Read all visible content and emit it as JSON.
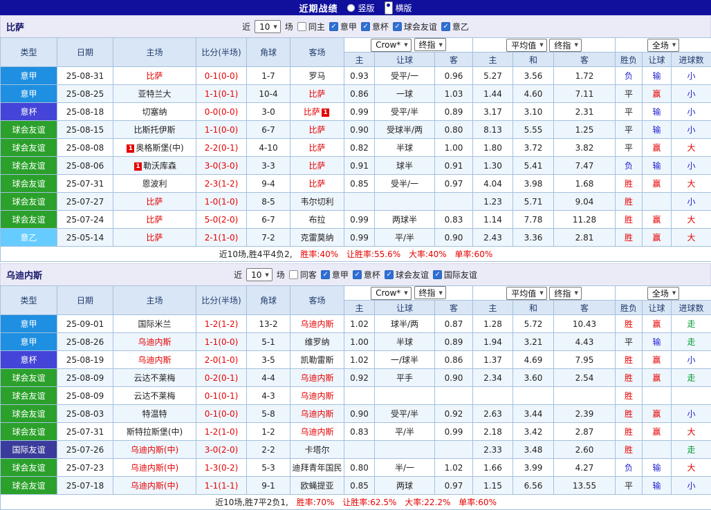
{
  "top_bar": {
    "title": "近期战绩",
    "view_options": [
      {
        "label": "竖版",
        "selected": false
      },
      {
        "label": "横版",
        "selected": true
      }
    ]
  },
  "table_headers": {
    "type": "类型",
    "date": "日期",
    "home": "主场",
    "score": "比分(半场)",
    "corners": "角球",
    "away": "客场",
    "odds_sub": [
      "主",
      "让球",
      "客"
    ],
    "avg_sub": [
      "主",
      "和",
      "客"
    ],
    "result_sub": [
      "胜负",
      "让球",
      "进球数"
    ]
  },
  "colors": {
    "serie_a_badge": "#1e8fe1",
    "coppa_badge": "#4444d8",
    "club_friendly_badge": "#2ba12b",
    "serie_b_badge": "#66ccff",
    "intl_friendly_badge": "#3b3b9b",
    "win_red": "#e60000",
    "lose_blue": "#1f1fd0",
    "walk_green": "#009933",
    "topbar_blue": "#10109d"
  },
  "sections": [
    {
      "team": "比萨",
      "filter": {
        "near_label": "近",
        "count": "10",
        "games_label": "场",
        "checkboxes": [
          {
            "label": "同主",
            "checked": false
          },
          {
            "label": "意甲",
            "checked": true
          },
          {
            "label": "意杯",
            "checked": true
          },
          {
            "label": "球会友谊",
            "checked": true
          },
          {
            "label": "意乙",
            "checked": true
          }
        ]
      },
      "selects": {
        "odds_source": "Crow*",
        "odds_kind": "终指",
        "avg": "平均值",
        "avg_kind": "终指",
        "scope": "全场"
      },
      "rows": [
        {
          "type": "意甲",
          "date": "25-08-31",
          "home": {
            "name": "比萨",
            "focus": true
          },
          "score": "0-1(0-0)",
          "corners": "1-7",
          "away": {
            "name": "罗马"
          },
          "odds": [
            "0.93",
            "受平/一",
            "0.96"
          ],
          "avg": [
            "5.27",
            "3.56",
            "1.72"
          ],
          "result": "负",
          "handicap": "输",
          "goals": "小"
        },
        {
          "type": "意甲",
          "date": "25-08-25",
          "home": {
            "name": "亚特兰大"
          },
          "score": "1-1(0-1)",
          "corners": "10-4",
          "away": {
            "name": "比萨",
            "focus": true
          },
          "odds": [
            "0.86",
            "一球",
            "1.03"
          ],
          "avg": [
            "1.44",
            "4.60",
            "7.11"
          ],
          "result": "平",
          "handicap": "赢",
          "goals": "小"
        },
        {
          "type": "意杯",
          "date": "25-08-18",
          "home": {
            "name": "切塞纳"
          },
          "score": "0-0(0-0)",
          "corners": "3-0",
          "away": {
            "name": "比萨",
            "focus": true,
            "badge": "1",
            "badge_pos": "after"
          },
          "odds": [
            "0.99",
            "受平/半",
            "0.89"
          ],
          "avg": [
            "3.17",
            "3.10",
            "2.31"
          ],
          "result": "平",
          "handicap": "输",
          "goals": "小"
        },
        {
          "type": "球会友谊",
          "date": "25-08-15",
          "home": {
            "name": "比斯托伊斯"
          },
          "score": "1-1(0-0)",
          "corners": "6-7",
          "away": {
            "name": "比萨",
            "focus": true
          },
          "odds": [
            "0.90",
            "受球半/两",
            "0.80"
          ],
          "avg": [
            "8.13",
            "5.55",
            "1.25"
          ],
          "result": "平",
          "handicap": "输",
          "goals": "小"
        },
        {
          "type": "球会友谊",
          "date": "25-08-08",
          "home": {
            "name": "奥格斯堡(中)",
            "badge": "1",
            "badge_pos": "before"
          },
          "score": "2-2(0-1)",
          "corners": "4-10",
          "away": {
            "name": "比萨",
            "focus": true
          },
          "odds": [
            "0.82",
            "半球",
            "1.00"
          ],
          "avg": [
            "1.80",
            "3.72",
            "3.82"
          ],
          "result": "平",
          "handicap": "赢",
          "goals": "大"
        },
        {
          "type": "球会友谊",
          "date": "25-08-06",
          "home": {
            "name": "勒沃库森",
            "badge": "1",
            "badge_pos": "before"
          },
          "score": "3-0(3-0)",
          "corners": "3-3",
          "away": {
            "name": "比萨",
            "focus": true
          },
          "odds": [
            "0.91",
            "球半",
            "0.91"
          ],
          "avg": [
            "1.30",
            "5.41",
            "7.47"
          ],
          "result": "负",
          "handicap": "输",
          "goals": "小"
        },
        {
          "type": "球会友谊",
          "date": "25-07-31",
          "home": {
            "name": "恩波利"
          },
          "score": "2-3(1-2)",
          "corners": "9-4",
          "away": {
            "name": "比萨",
            "focus": true
          },
          "odds": [
            "0.85",
            "受半/一",
            "0.97"
          ],
          "avg": [
            "4.04",
            "3.98",
            "1.68"
          ],
          "result": "胜",
          "handicap": "赢",
          "goals": "大"
        },
        {
          "type": "球会友谊",
          "date": "25-07-27",
          "home": {
            "name": "比萨",
            "focus": true
          },
          "score": "1-0(1-0)",
          "corners": "8-5",
          "away": {
            "name": "韦尔切利"
          },
          "odds": [
            "",
            "",
            ""
          ],
          "avg": [
            "1.23",
            "5.71",
            "9.04"
          ],
          "result": "胜",
          "handicap": "",
          "goals": "小"
        },
        {
          "type": "球会友谊",
          "date": "25-07-24",
          "home": {
            "name": "比萨",
            "focus": true
          },
          "score": "5-0(2-0)",
          "corners": "6-7",
          "away": {
            "name": "布拉"
          },
          "odds": [
            "0.99",
            "两球半",
            "0.83"
          ],
          "avg": [
            "1.14",
            "7.78",
            "11.28"
          ],
          "result": "胜",
          "handicap": "赢",
          "goals": "大"
        },
        {
          "type": "意乙",
          "date": "25-05-14",
          "home": {
            "name": "比萨",
            "focus": true
          },
          "score": "2-1(1-0)",
          "corners": "7-2",
          "away": {
            "name": "克雷莫纳"
          },
          "odds": [
            "0.99",
            "平/半",
            "0.90"
          ],
          "avg": [
            "2.43",
            "3.36",
            "2.81"
          ],
          "result": "胜",
          "handicap": "赢",
          "goals": "大"
        }
      ],
      "summary": {
        "prefix": "近10场,胜4平4负2,",
        "rates": [
          "胜率:40%",
          "让胜率:55.6%",
          "大率:40%",
          "单率:60%"
        ]
      }
    },
    {
      "team": "乌迪内斯",
      "filter": {
        "near_label": "近",
        "count": "10",
        "games_label": "场",
        "checkboxes": [
          {
            "label": "同客",
            "checked": false
          },
          {
            "label": "意甲",
            "checked": true
          },
          {
            "label": "意杯",
            "checked": true
          },
          {
            "label": "球会友谊",
            "checked": true
          },
          {
            "label": "国际友谊",
            "checked": true
          }
        ]
      },
      "selects": {
        "odds_source": "Crow*",
        "odds_kind": "终指",
        "avg": "平均值",
        "avg_kind": "终指",
        "scope": "全场"
      },
      "rows": [
        {
          "type": "意甲",
          "date": "25-09-01",
          "home": {
            "name": "国际米兰"
          },
          "score": "1-2(1-2)",
          "corners": "13-2",
          "away": {
            "name": "乌迪内斯",
            "focus": true
          },
          "odds": [
            "1.02",
            "球半/两",
            "0.87"
          ],
          "avg": [
            "1.28",
            "5.72",
            "10.43"
          ],
          "result": "胜",
          "handicap": "赢",
          "goals": "走"
        },
        {
          "type": "意甲",
          "date": "25-08-26",
          "home": {
            "name": "乌迪内斯",
            "focus": true
          },
          "score": "1-1(0-0)",
          "corners": "5-1",
          "away": {
            "name": "维罗纳"
          },
          "odds": [
            "1.00",
            "半球",
            "0.89"
          ],
          "avg": [
            "1.94",
            "3.21",
            "4.43"
          ],
          "result": "平",
          "handicap": "输",
          "goals": "走"
        },
        {
          "type": "意杯",
          "date": "25-08-19",
          "home": {
            "name": "乌迪内斯",
            "focus": true
          },
          "score": "2-0(1-0)",
          "corners": "3-5",
          "away": {
            "name": "凯勒雷斯"
          },
          "odds": [
            "1.02",
            "一/球半",
            "0.86"
          ],
          "avg": [
            "1.37",
            "4.69",
            "7.95"
          ],
          "result": "胜",
          "handicap": "赢",
          "goals": "小"
        },
        {
          "type": "球会友谊",
          "date": "25-08-09",
          "home": {
            "name": "云达不莱梅"
          },
          "score": "0-2(0-1)",
          "corners": "4-4",
          "away": {
            "name": "乌迪内斯",
            "focus": true
          },
          "odds": [
            "0.92",
            "平手",
            "0.90"
          ],
          "avg": [
            "2.34",
            "3.60",
            "2.54"
          ],
          "result": "胜",
          "handicap": "赢",
          "goals": "走"
        },
        {
          "type": "球会友谊",
          "date": "25-08-09",
          "home": {
            "name": "云达不莱梅"
          },
          "score": "0-1(0-1)",
          "corners": "4-3",
          "away": {
            "name": "乌迪内斯",
            "focus": true
          },
          "odds": [
            "",
            "",
            ""
          ],
          "avg": [
            "",
            "",
            ""
          ],
          "result": "胜",
          "handicap": "",
          "goals": ""
        },
        {
          "type": "球会友谊",
          "date": "25-08-03",
          "home": {
            "name": "特温特"
          },
          "score": "0-1(0-0)",
          "corners": "5-8",
          "away": {
            "name": "乌迪内斯",
            "focus": true
          },
          "odds": [
            "0.90",
            "受平/半",
            "0.92"
          ],
          "avg": [
            "2.63",
            "3.44",
            "2.39"
          ],
          "result": "胜",
          "handicap": "赢",
          "goals": "小"
        },
        {
          "type": "球会友谊",
          "date": "25-07-31",
          "home": {
            "name": "斯特拉斯堡(中)"
          },
          "score": "1-2(1-0)",
          "corners": "1-2",
          "away": {
            "name": "乌迪内斯",
            "focus": true
          },
          "odds": [
            "0.83",
            "平/半",
            "0.99"
          ],
          "avg": [
            "2.18",
            "3.42",
            "2.87"
          ],
          "result": "胜",
          "handicap": "赢",
          "goals": "大"
        },
        {
          "type": "国际友谊",
          "date": "25-07-26",
          "home": {
            "name": "乌迪内斯(中)",
            "focus": true
          },
          "score": "3-0(2-0)",
          "corners": "2-2",
          "away": {
            "name": "卡塔尔"
          },
          "odds": [
            "",
            "",
            ""
          ],
          "avg": [
            "2.33",
            "3.48",
            "2.60"
          ],
          "result": "胜",
          "handicap": "",
          "goals": "走"
        },
        {
          "type": "球会友谊",
          "date": "25-07-23",
          "home": {
            "name": "乌迪内斯(中)",
            "focus": true
          },
          "score": "1-3(0-2)",
          "corners": "5-3",
          "away": {
            "name": "迪拜青年国民"
          },
          "odds": [
            "0.80",
            "半/一",
            "1.02"
          ],
          "avg": [
            "1.66",
            "3.99",
            "4.27"
          ],
          "result": "负",
          "handicap": "输",
          "goals": "大"
        },
        {
          "type": "球会友谊",
          "date": "25-07-18",
          "home": {
            "name": "乌迪内斯(中)",
            "focus": true
          },
          "score": "1-1(1-1)",
          "corners": "9-1",
          "away": {
            "name": "欧蝇提亚"
          },
          "odds": [
            "0.85",
            "两球",
            "0.97"
          ],
          "avg": [
            "1.15",
            "6.56",
            "13.55"
          ],
          "result": "平",
          "handicap": "输",
          "goals": "小"
        }
      ],
      "summary": {
        "prefix": "近10场,胜7平2负1,",
        "rates": [
          "胜率:70%",
          "让胜率:62.5%",
          "大率:22.2%",
          "单率:60%"
        ]
      }
    }
  ]
}
